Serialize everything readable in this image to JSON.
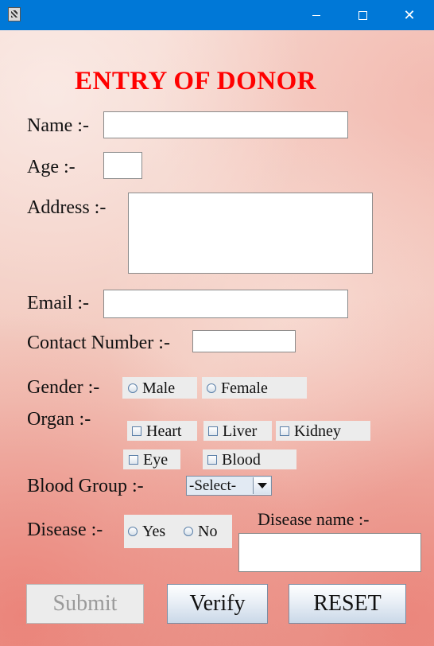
{
  "window": {
    "title": "",
    "icons": {
      "app": "app-icon",
      "minimize": "minimize-icon",
      "maximize": "maximize-icon",
      "close": "close-icon"
    },
    "titlebar_color": "#0078d7",
    "close_glyph": "✕"
  },
  "form": {
    "heading": "ENTRY OF DONOR",
    "heading_color": "#ff0000",
    "name_label": "Name :-",
    "name_value": "",
    "age_label": "Age :-",
    "age_value": "",
    "address_label": "Address :-",
    "address_value": "",
    "email_label": "Email :-",
    "email_value": "",
    "contact_label": "Contact Number :-",
    "contact_value": "",
    "gender": {
      "label": "Gender :-",
      "options": [
        "Male",
        "Female"
      ],
      "selected": null
    },
    "organ": {
      "label": "Organ :-",
      "options": [
        "Heart",
        "Liver",
        "Kidney",
        "Eye",
        "Blood"
      ],
      "checked": []
    },
    "blood_group": {
      "label": "Blood Group :-",
      "selected": "-Select-"
    },
    "disease": {
      "label": "Disease :-",
      "options": [
        "Yes",
        "No"
      ],
      "selected": null,
      "name_label": "Disease name :-",
      "name_value": ""
    }
  },
  "buttons": {
    "submit": "Submit",
    "submit_enabled": false,
    "verify": "Verify",
    "reset": "RESET"
  }
}
